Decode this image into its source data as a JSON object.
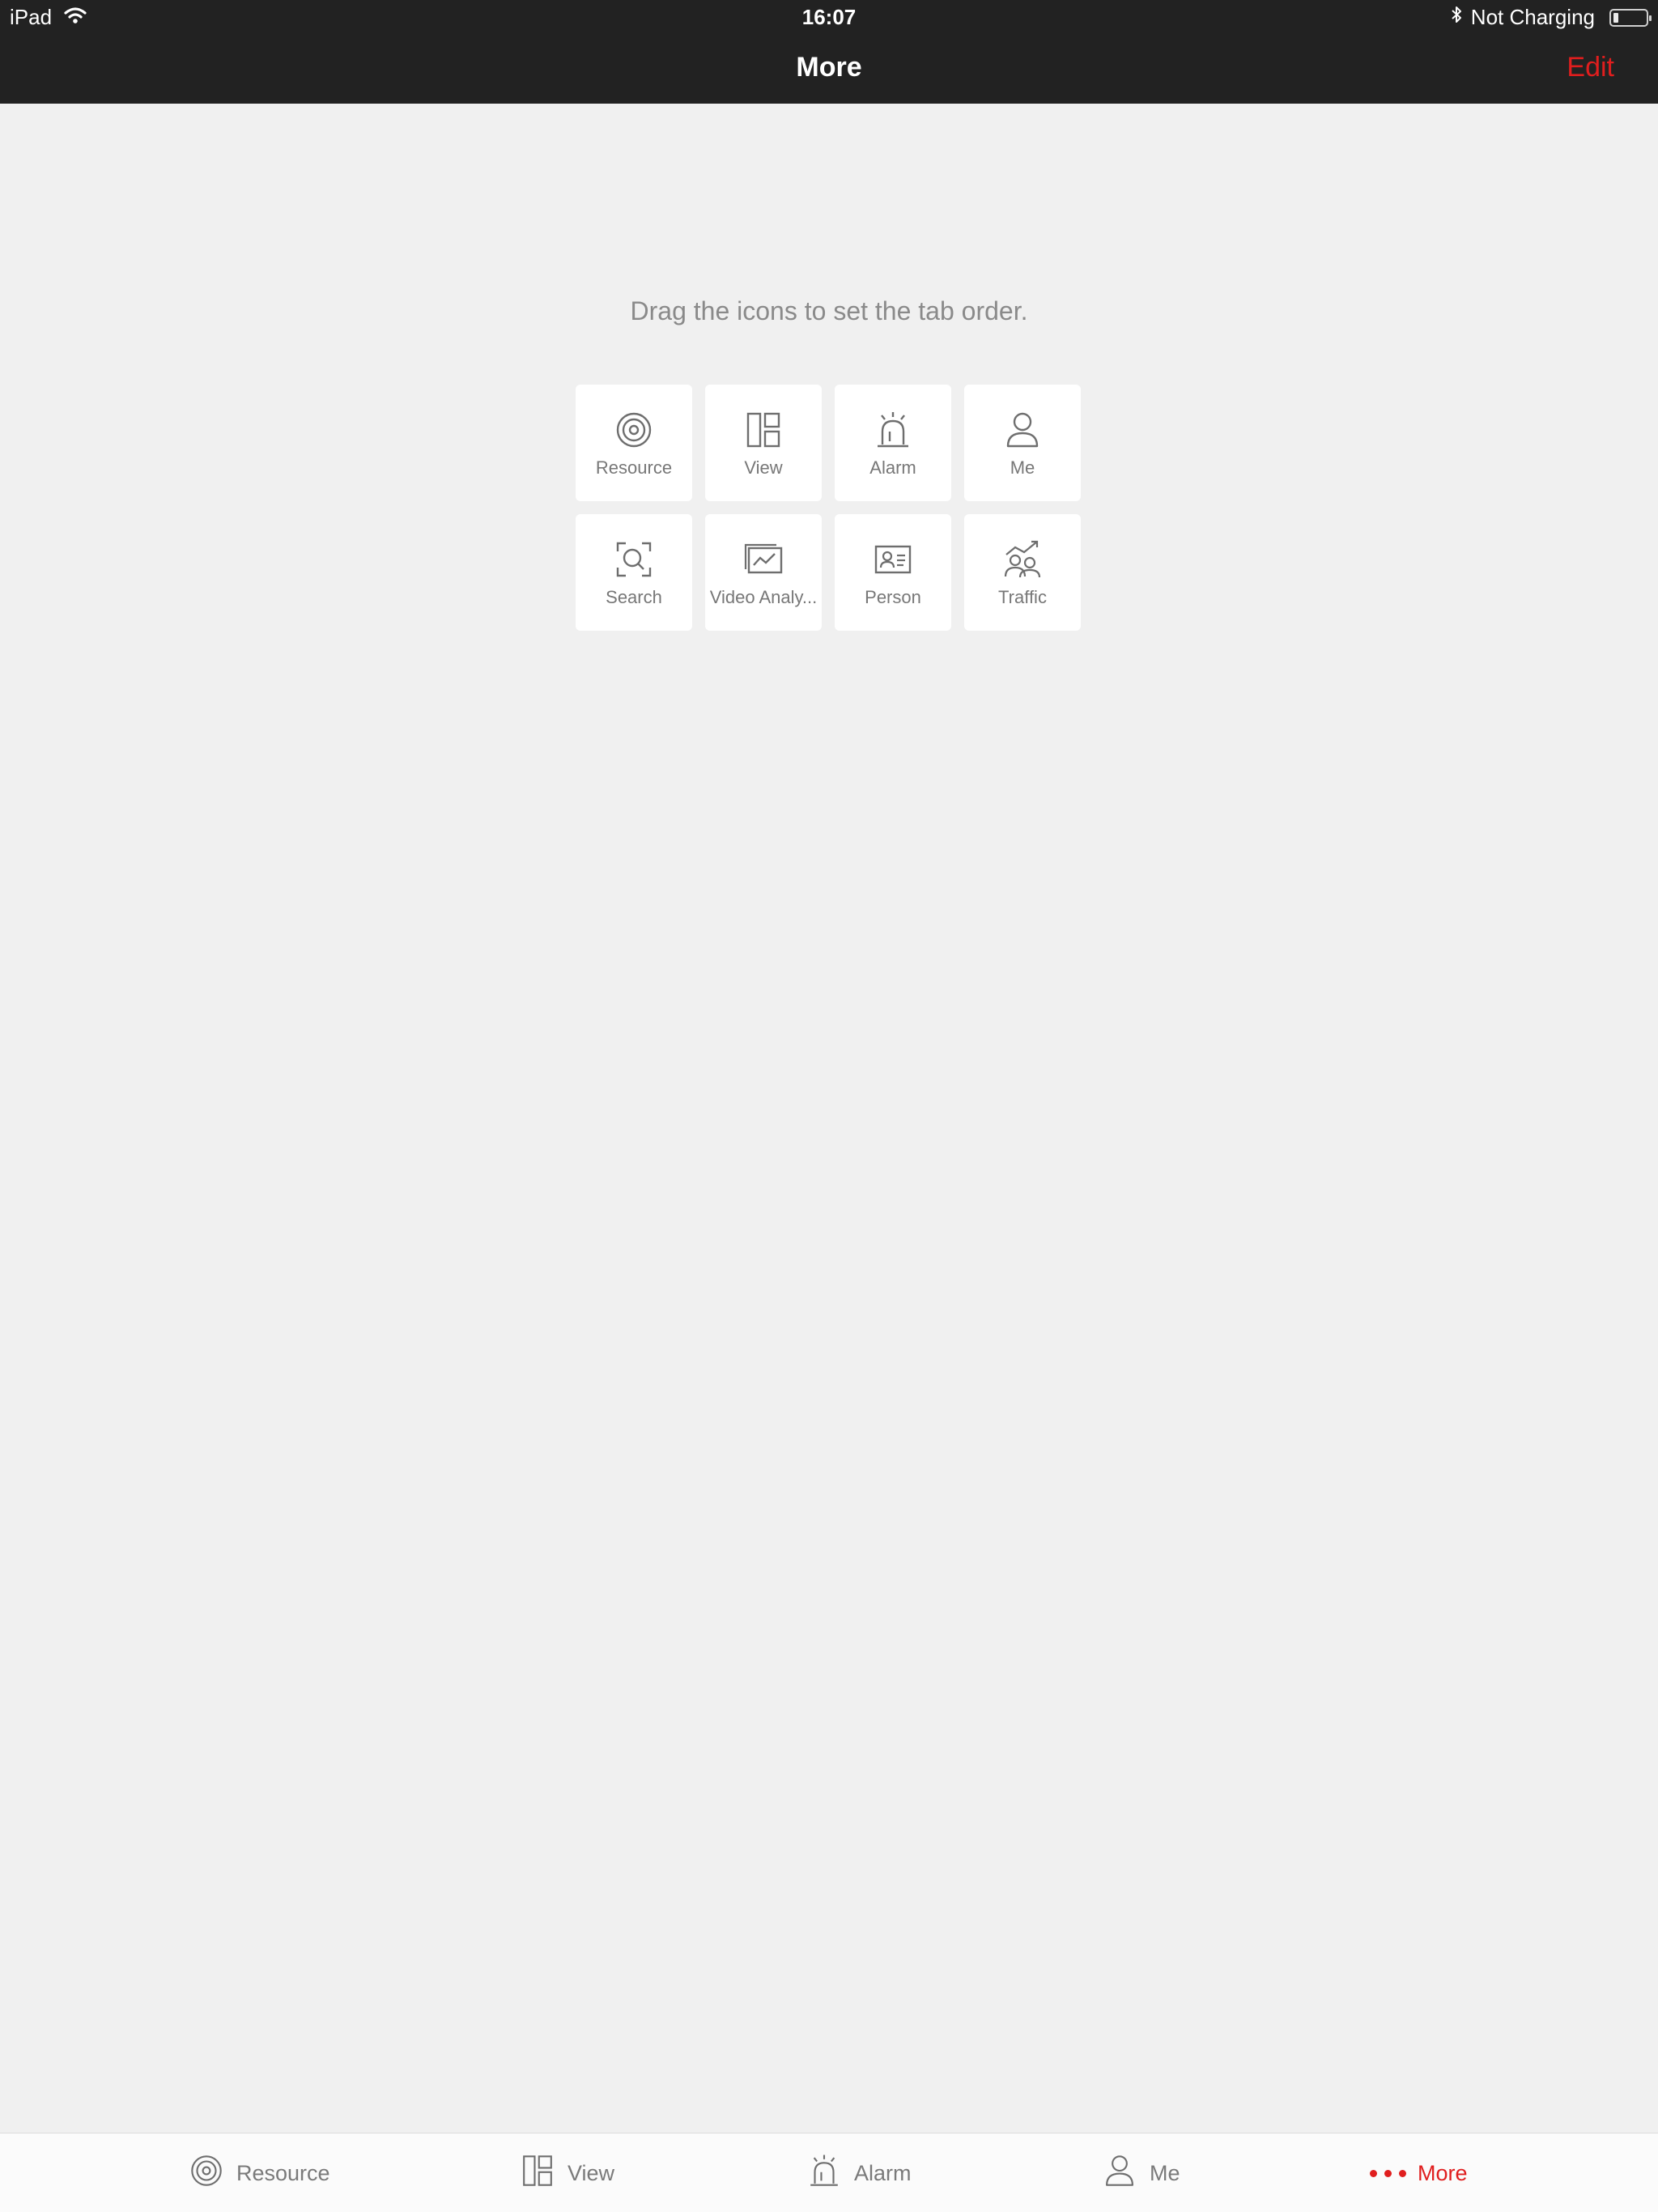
{
  "status_bar": {
    "device": "iPad",
    "time": "16:07",
    "charging": "Not Charging",
    "icons": [
      "wifi-icon",
      "bluetooth-icon",
      "battery-icon"
    ]
  },
  "nav": {
    "title": "More",
    "edit_label": "Edit"
  },
  "main": {
    "hint": "Drag the icons to set the tab order.",
    "tiles": [
      {
        "label": "Resource",
        "icon": "camera-icon"
      },
      {
        "label": "View",
        "icon": "layout-icon"
      },
      {
        "label": "Alarm",
        "icon": "alarm-icon"
      },
      {
        "label": "Me",
        "icon": "person-icon"
      },
      {
        "label": "Search",
        "icon": "search-icon"
      },
      {
        "label": "Video Analy...",
        "icon": "chart-icon"
      },
      {
        "label": "Person",
        "icon": "id-card-icon"
      },
      {
        "label": "Traffic",
        "icon": "traffic-icon"
      }
    ]
  },
  "tabbar": {
    "tabs": [
      {
        "label": "Resource",
        "icon": "camera-icon"
      },
      {
        "label": "View",
        "icon": "layout-icon"
      },
      {
        "label": "Alarm",
        "icon": "alarm-icon"
      },
      {
        "label": "Me",
        "icon": "person-icon"
      },
      {
        "label": "More",
        "icon": "more-dots-icon",
        "active": true
      }
    ]
  },
  "colors": {
    "accent": "#e01e1e",
    "header_bg": "#222222",
    "page_bg": "#f0f0f0",
    "icon_gray": "#6e6e6e"
  }
}
